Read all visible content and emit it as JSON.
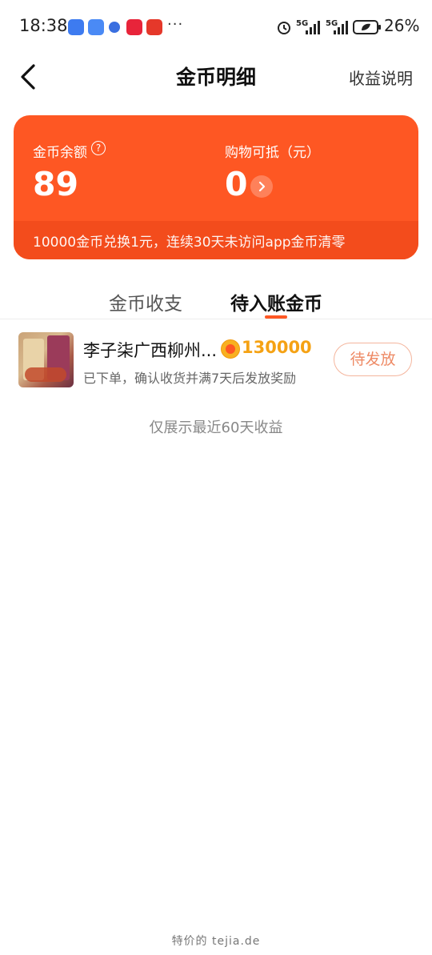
{
  "status_bar": {
    "time": "18:38",
    "more_dots": "···",
    "signal1": "5G",
    "signal2": "5G",
    "battery": "26%"
  },
  "nav": {
    "title": "金币明细",
    "right_action": "收益说明"
  },
  "card": {
    "balance_label": "金币余额",
    "balance_value": "89",
    "help_glyph": "?",
    "offset_label": "购物可抵（元）",
    "offset_value": "0",
    "note": "10000金币兑换1元，连续30天未访问app金币清零",
    "colors": {
      "primary": "#fe5723",
      "footer": "#f34c1c"
    }
  },
  "tabs": [
    {
      "label": "金币收支",
      "active": false
    },
    {
      "label": "待入账金币",
      "active": true
    }
  ],
  "items": [
    {
      "title": "李子柒广西柳州...",
      "coins": "130000",
      "subtitle": "已下单，确认收货并满7天后发放奖励",
      "status": "待发放"
    }
  ],
  "footer_note": "仅展示最近60天收益",
  "watermark": "特价的 tejia.de"
}
